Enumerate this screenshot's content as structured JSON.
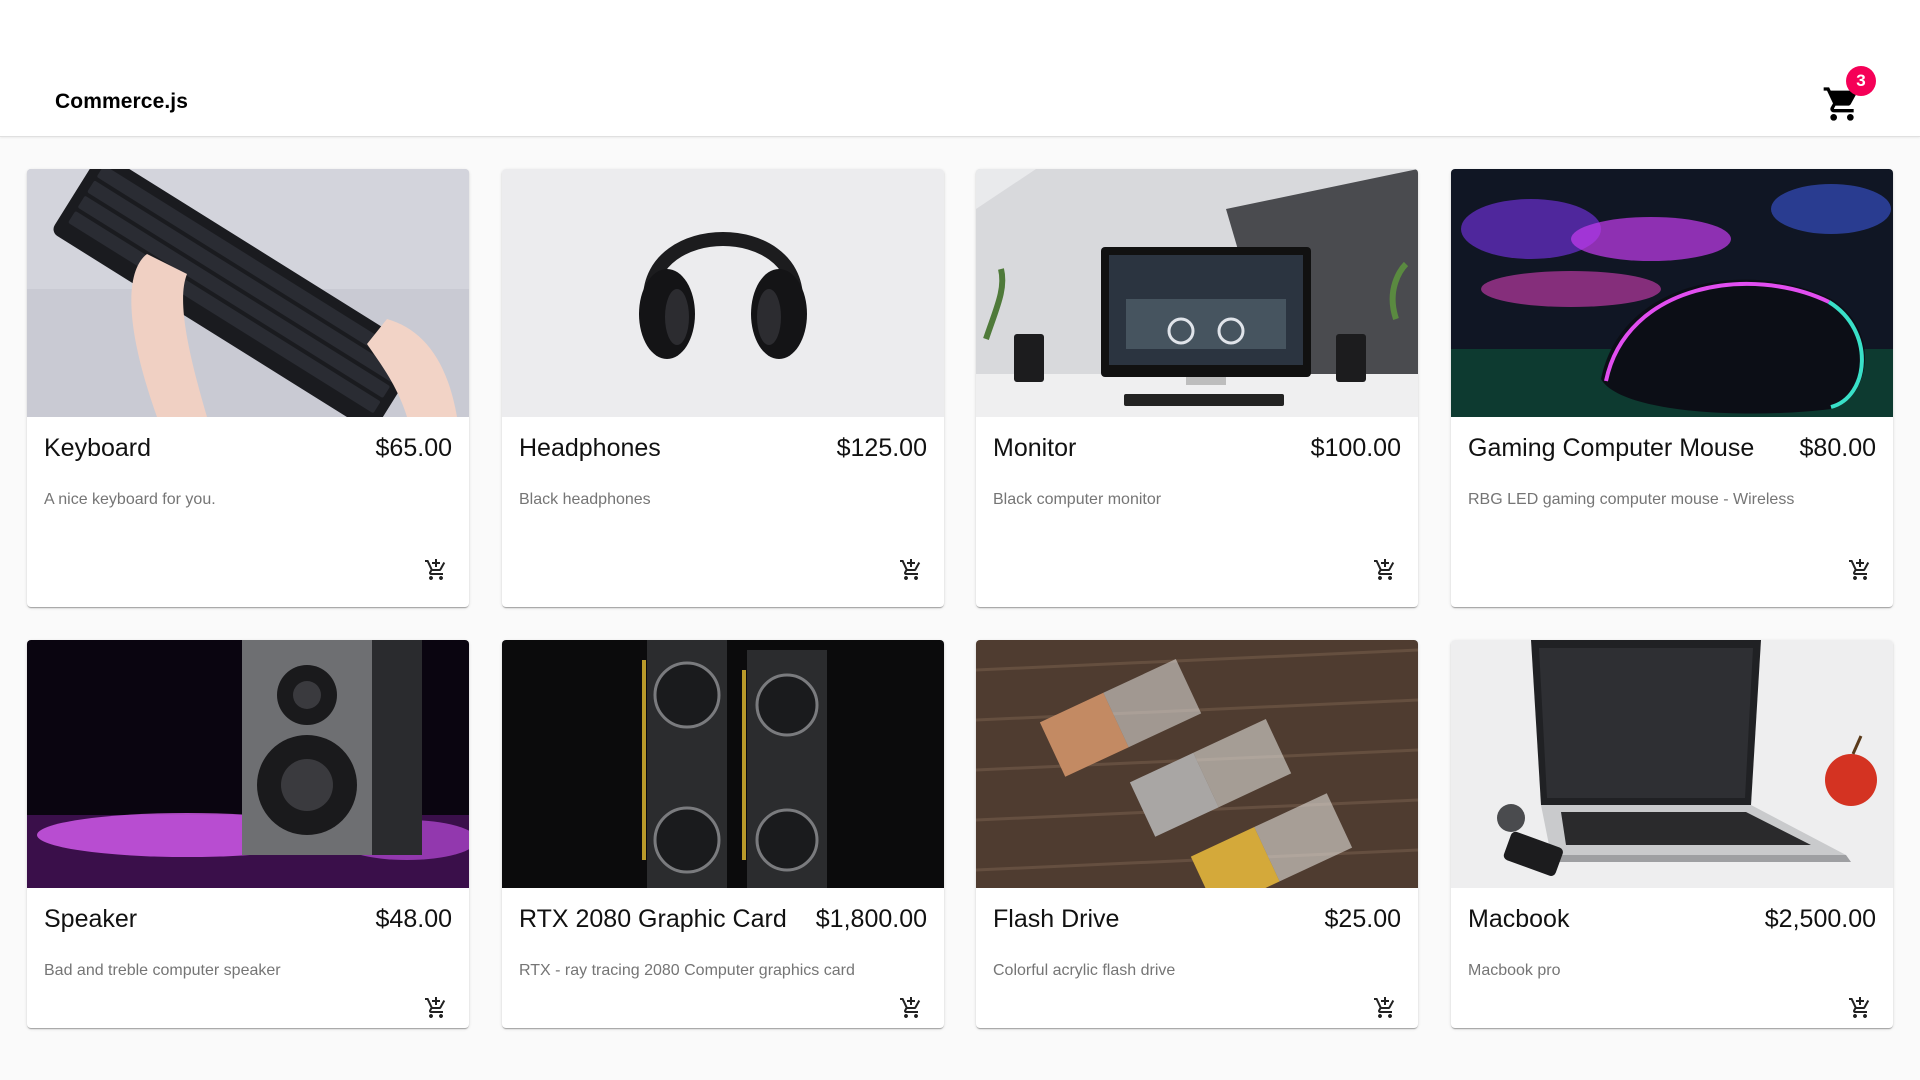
{
  "header": {
    "brand": "Commerce.js",
    "cart_count": "3",
    "cart_icon": "shopping-cart-icon",
    "badge_color": "#f50057"
  },
  "products": [
    {
      "name": "Keyboard",
      "price": "$65.00",
      "description": "A nice keyboard for you.",
      "image": "keyboard-photo"
    },
    {
      "name": "Headphones",
      "price": "$125.00",
      "description": "Black headphones",
      "image": "headphones-photo"
    },
    {
      "name": "Monitor",
      "price": "$100.00",
      "description": "Black computer monitor",
      "image": "monitor-photo"
    },
    {
      "name": "Gaming Computer Mouse",
      "price": "$80.00",
      "description": "RBG LED gaming computer mouse - Wireless",
      "image": "gaming-mouse-photo"
    },
    {
      "name": "Speaker",
      "price": "$48.00",
      "description": "Bad and treble computer speaker",
      "image": "speaker-photo"
    },
    {
      "name": "RTX 2080 Graphic Card",
      "price": "$1,800.00",
      "description": "RTX - ray tracing 2080 Computer graphics card",
      "image": "graphics-card-photo"
    },
    {
      "name": "Flash Drive",
      "price": "$25.00",
      "description": "Colorful acrylic flash drive",
      "image": "flash-drive-photo"
    },
    {
      "name": "Macbook",
      "price": "$2,500.00",
      "description": "Macbook pro",
      "image": "macbook-photo"
    }
  ],
  "add_to_cart_icon": "add-shopping-cart-icon"
}
